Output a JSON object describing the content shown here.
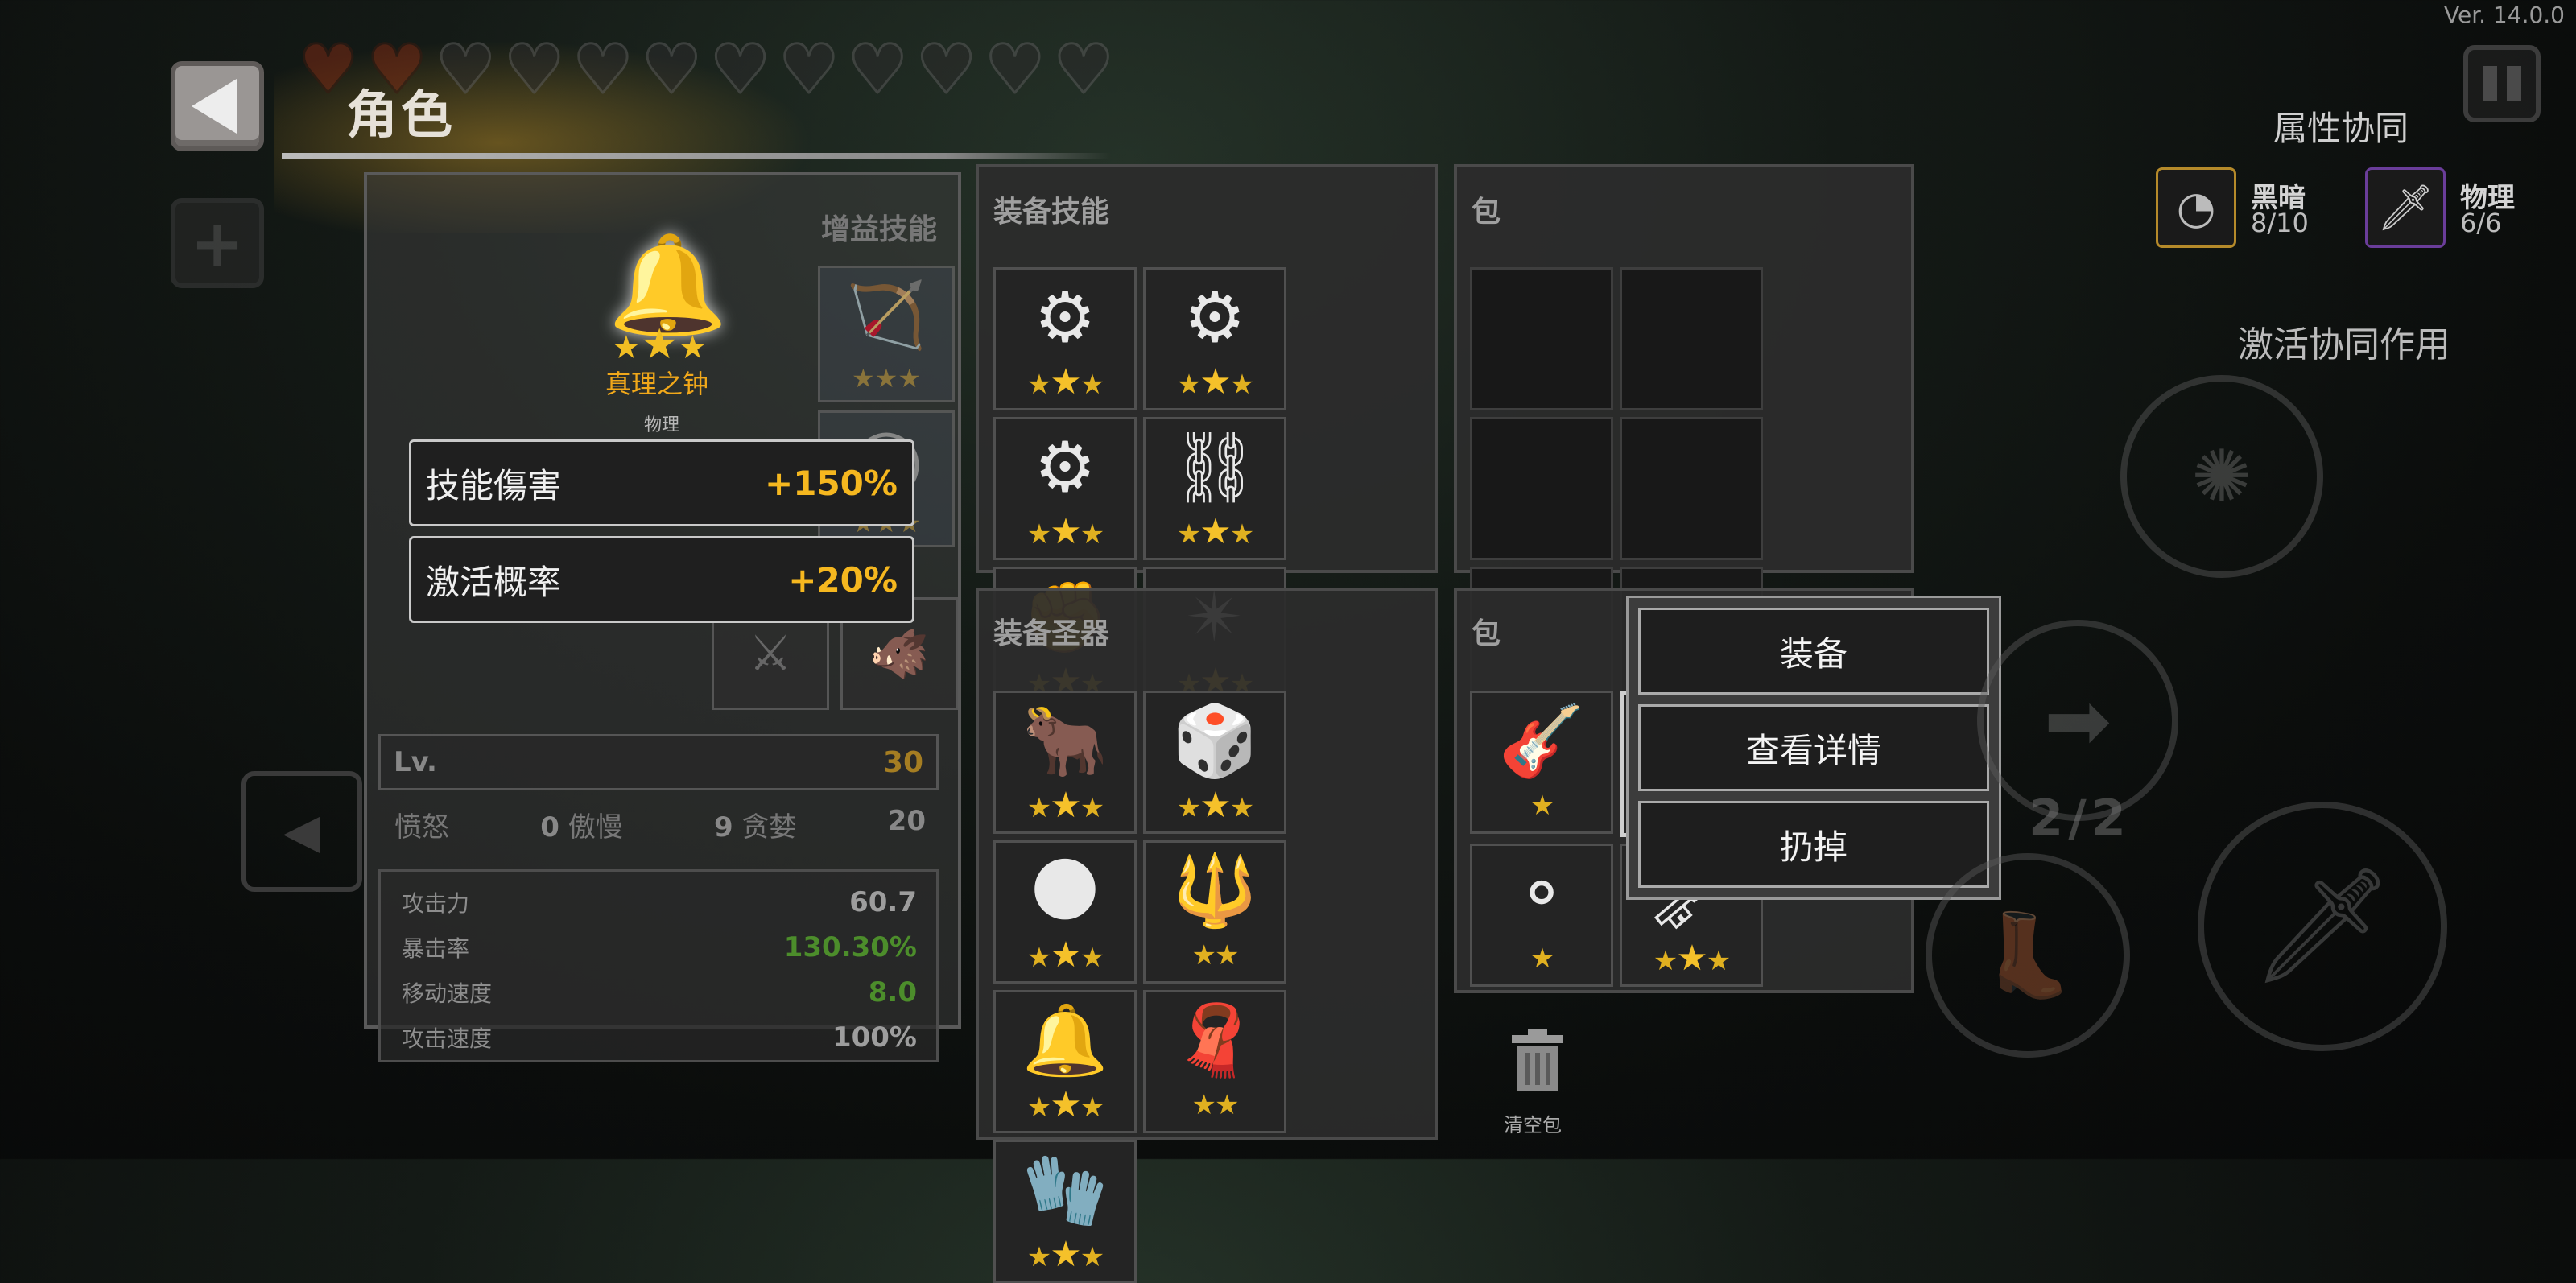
{
  "version": "Ver. 14.0.0",
  "header": {
    "title": "角色"
  },
  "hearts": {
    "full": 2,
    "total": 12
  },
  "character": {
    "buff_skill_title": "增益技能",
    "main_item": {
      "name": "真理之钟",
      "type": "物理",
      "icon": "bell-icon",
      "stars": 3
    },
    "stats_popup": [
      {
        "label": "技能傷害",
        "value": "+150%"
      },
      {
        "label": "激活概率",
        "value": "+20%"
      }
    ],
    "level": {
      "label": "Lv.",
      "value": "30"
    },
    "sins": [
      {
        "label": "愤怒",
        "value": "0"
      },
      {
        "label": "傲慢",
        "value": "9"
      },
      {
        "label": "贪婪",
        "value": "20"
      }
    ],
    "attributes": [
      {
        "label": "攻击力",
        "value": "60.7",
        "highlight": false
      },
      {
        "label": "暴击率",
        "value": "130.30%",
        "highlight": true
      },
      {
        "label": "移动速度",
        "value": "8.0",
        "highlight": true
      },
      {
        "label": "攻击速度",
        "value": "100%",
        "highlight": false
      }
    ]
  },
  "equip_skills": {
    "title": "装备技能",
    "slots": [
      {
        "icon": "⚙",
        "name": "gear-ring-icon",
        "stars": 3
      },
      {
        "icon": "⚙",
        "name": "gear-ring-icon",
        "stars": 3
      },
      {
        "icon": "⚙",
        "name": "gear-ring-icon",
        "stars": 3
      },
      {
        "icon": "⛓",
        "name": "hook-launcher-icon",
        "stars": 3
      },
      {
        "icon": "✊",
        "name": "gauntlet-icon",
        "stars": 3
      },
      {
        "icon": "✴",
        "name": "crack-icon",
        "stars": 3
      }
    ]
  },
  "skill_bag": {
    "title": "包",
    "slots": 6
  },
  "equip_relics": {
    "title": "装备圣器",
    "slots": [
      {
        "icon": "🐂",
        "name": "golden-ox-icon",
        "stars": 3
      },
      {
        "icon": "🎲",
        "name": "green-dice-icon",
        "stars": 3
      },
      {
        "icon": "🌑",
        "name": "dark-moon-icon",
        "stars": 3
      },
      {
        "icon": "🔱",
        "name": "dark-staff-icon",
        "stars": 2
      },
      {
        "icon": "🔔",
        "name": "dark-bell-icon",
        "stars": 3
      },
      {
        "icon": "🧣",
        "name": "red-scarf-icon",
        "stars": 2
      },
      {
        "icon": "🧤",
        "name": "dark-glove-icon",
        "stars": 3
      }
    ]
  },
  "relic_bag": {
    "title": "包",
    "slots": [
      {
        "icon": "🎸",
        "name": "lute-icon",
        "stars": 1,
        "selected": false
      },
      {
        "icon": "🔔",
        "name": "golden-bell-icon",
        "stars": 3,
        "selected": true
      },
      {
        "icon": "⚬",
        "name": "small-orb-icon",
        "stars": 1,
        "selected": false
      },
      {
        "icon": "🗝",
        "name": "golden-key-icon",
        "stars": 3,
        "selected": false
      }
    ]
  },
  "context_menu": {
    "equip": "装备",
    "details": "查看详情",
    "discard": "扔掉"
  },
  "clear_bag": {
    "label": "清空包"
  },
  "synergy": {
    "title": "属性协同",
    "items": [
      {
        "name": "黑暗",
        "value": "8/10",
        "color": "#b58a2a"
      },
      {
        "name": "物理",
        "value": "6/6",
        "color": "#6a3d9a"
      }
    ],
    "activate_label": "激活协同作用"
  },
  "hud": {
    "wave": "2/2"
  }
}
